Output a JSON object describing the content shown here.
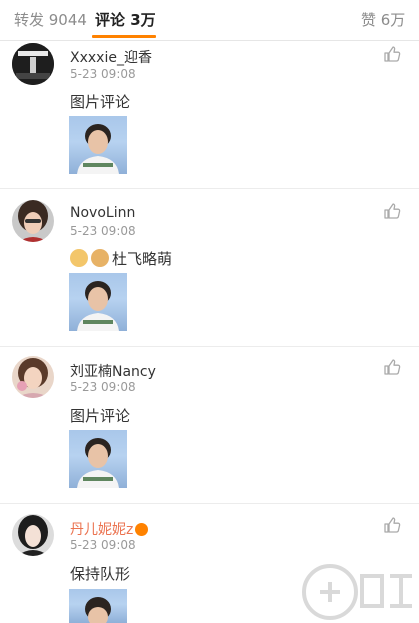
{
  "tabs": {
    "repost": "转发 9044",
    "comments": "评论 3万",
    "likes": "赞 6万"
  },
  "comments": [
    {
      "username": "Xxxxie_迎香",
      "time": "5-23 09:08",
      "text": "图片评论"
    },
    {
      "username": "NovoLinn",
      "time": "5-23 09:08",
      "text": "杜飞略萌"
    },
    {
      "username": "刘亚楠Nancy",
      "time": "5-23 09:08",
      "text": "图片评论"
    },
    {
      "username": "丹儿妮妮z",
      "time": "5-23 09:08",
      "text": "保持队形"
    }
  ],
  "colors": {
    "accent": "#ff8200",
    "vip_name": "#eb7350",
    "meta": "#999999"
  }
}
